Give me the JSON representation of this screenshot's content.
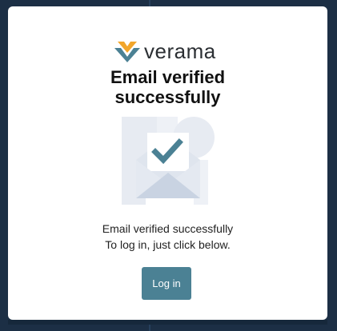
{
  "brand": {
    "name": "verama",
    "logo_icon": "verama-logo-icon",
    "colors": {
      "chevron_top": "#f2a62b",
      "chevron_bottom": "#4b8194"
    }
  },
  "page": {
    "title_line1": "Email verified",
    "title_line2": "successfully"
  },
  "illustration": {
    "icon": "envelope-check-icon",
    "colors": {
      "shapes": "#e7ebf2",
      "envelope": "#c9d3e2",
      "check": "#4b8194"
    }
  },
  "message": {
    "line1": "Email verified successfully",
    "line2": "To log in, just click below."
  },
  "actions": {
    "login_label": "Log in",
    "accent": "#4b8194"
  },
  "theme": {
    "background": "#1c2f45",
    "card": "#ffffff"
  }
}
